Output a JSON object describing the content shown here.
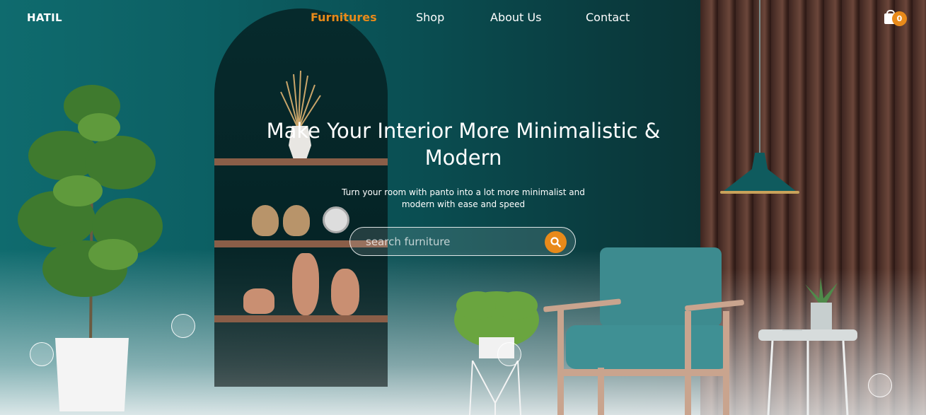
{
  "nav": {
    "logo": "HATIL",
    "links": [
      "Furnitures",
      "Shop",
      "About Us",
      "Contact"
    ],
    "active_link": "Furnitures",
    "cart_count": "0"
  },
  "hero": {
    "headline": "Make Your Interior More Minimalistic & Modern",
    "subtitle": "Turn your room with panto into a lot more minimalist and modern with ease and speed",
    "search_placeholder": "search furniture"
  },
  "colors": {
    "accent": "#e88a1a",
    "teal": "#0c5e62",
    "dark_teal": "#0a3436",
    "wood": "#5a3a30"
  },
  "icons": {
    "cart": "shopping-bag-icon",
    "search": "search-icon"
  }
}
